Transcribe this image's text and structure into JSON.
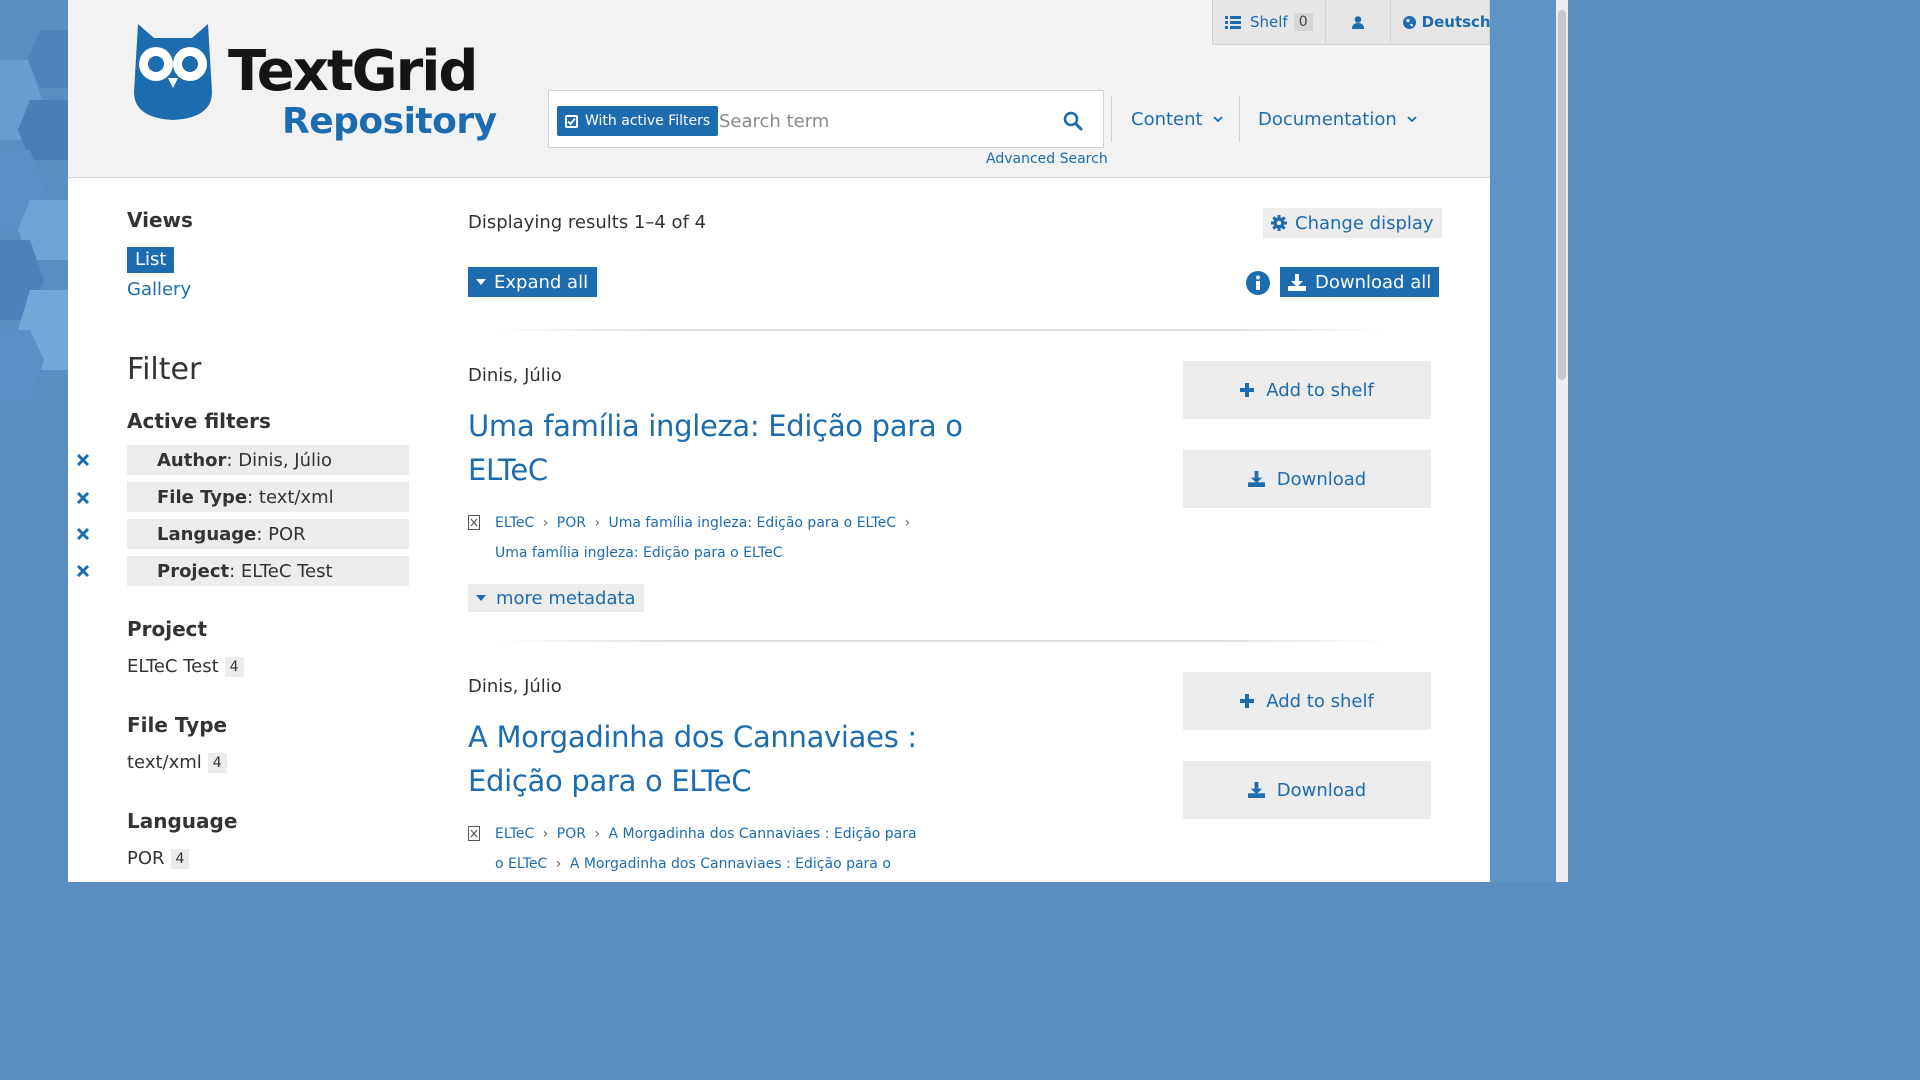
{
  "logo": {
    "line1": "TextGrid",
    "line2": "Repository"
  },
  "topbar": {
    "shelf_label": "Shelf",
    "shelf_count": "0",
    "language": "Deutsch"
  },
  "search": {
    "filter_button": "With active Filters",
    "placeholder": "Search term",
    "advanced": "Advanced Search"
  },
  "nav": {
    "content": "Content",
    "documentation": "Documentation"
  },
  "sidebar": {
    "views_heading": "Views",
    "views": [
      "List",
      "Gallery"
    ],
    "filter_heading": "Filter",
    "active_heading": "Active filters",
    "active_filters": [
      {
        "key": "Author",
        "value": ": Dinis, Júlio"
      },
      {
        "key": "File Type",
        "value": ": text/xml"
      },
      {
        "key": "Language",
        "value": ": POR"
      },
      {
        "key": "Project",
        "value": ": ELTeC Test"
      }
    ],
    "facets": [
      {
        "heading": "Project",
        "value": "ELTeC Test",
        "count": "4"
      },
      {
        "heading": "File Type",
        "value": "text/xml",
        "count": "4"
      },
      {
        "heading": "Language",
        "value": "POR",
        "count": "4"
      }
    ]
  },
  "results": {
    "info": "Displaying results 1–4 of 4",
    "change_display": "Change display",
    "expand_all": "Expand all",
    "download_all": "Download all",
    "more_metadata": "more metadata",
    "add_to_shelf": "Add to shelf",
    "download": "Download",
    "items": [
      {
        "author": "Dinis, Júlio",
        "title": "Uma família ingleza: Edição para o ELTeC",
        "path_line1": [
          "ELTeC",
          "POR",
          "Uma família ingleza: Edição para o ELTeC"
        ],
        "path_line2": [
          "Uma família ingleza: Edição para o ELTeC"
        ]
      },
      {
        "author": "Dinis, Júlio",
        "title": "A Morgadinha dos Cannaviaes : Edição para o ELTeC",
        "path_line1": [
          "ELTeC",
          "POR",
          "A Morgadinha dos Cannaviaes : Edição para"
        ],
        "path_line2": [
          "o ELTeC",
          "A Morgadinha dos Cannaviaes : Edição para o"
        ]
      }
    ]
  },
  "colors": {
    "accent": "#1d6cb0",
    "background": "#5b8ec0",
    "header": "#f2f2f2"
  }
}
